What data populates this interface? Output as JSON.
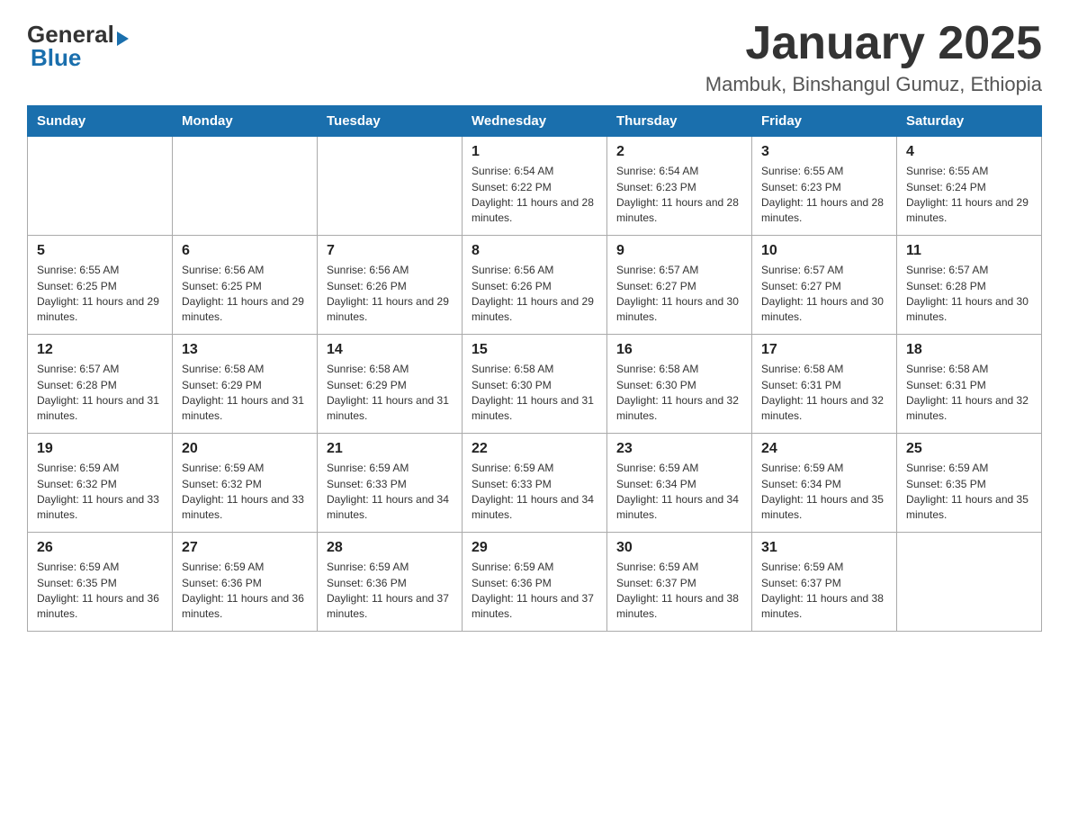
{
  "header": {
    "logo_general": "General",
    "logo_blue": "Blue",
    "title": "January 2025",
    "subtitle": "Mambuk, Binshangul Gumuz, Ethiopia"
  },
  "weekdays": [
    "Sunday",
    "Monday",
    "Tuesday",
    "Wednesday",
    "Thursday",
    "Friday",
    "Saturday"
  ],
  "weeks": [
    [
      {
        "day": "",
        "info": ""
      },
      {
        "day": "",
        "info": ""
      },
      {
        "day": "",
        "info": ""
      },
      {
        "day": "1",
        "info": "Sunrise: 6:54 AM\nSunset: 6:22 PM\nDaylight: 11 hours and 28 minutes."
      },
      {
        "day": "2",
        "info": "Sunrise: 6:54 AM\nSunset: 6:23 PM\nDaylight: 11 hours and 28 minutes."
      },
      {
        "day": "3",
        "info": "Sunrise: 6:55 AM\nSunset: 6:23 PM\nDaylight: 11 hours and 28 minutes."
      },
      {
        "day": "4",
        "info": "Sunrise: 6:55 AM\nSunset: 6:24 PM\nDaylight: 11 hours and 29 minutes."
      }
    ],
    [
      {
        "day": "5",
        "info": "Sunrise: 6:55 AM\nSunset: 6:25 PM\nDaylight: 11 hours and 29 minutes."
      },
      {
        "day": "6",
        "info": "Sunrise: 6:56 AM\nSunset: 6:25 PM\nDaylight: 11 hours and 29 minutes."
      },
      {
        "day": "7",
        "info": "Sunrise: 6:56 AM\nSunset: 6:26 PM\nDaylight: 11 hours and 29 minutes."
      },
      {
        "day": "8",
        "info": "Sunrise: 6:56 AM\nSunset: 6:26 PM\nDaylight: 11 hours and 29 minutes."
      },
      {
        "day": "9",
        "info": "Sunrise: 6:57 AM\nSunset: 6:27 PM\nDaylight: 11 hours and 30 minutes."
      },
      {
        "day": "10",
        "info": "Sunrise: 6:57 AM\nSunset: 6:27 PM\nDaylight: 11 hours and 30 minutes."
      },
      {
        "day": "11",
        "info": "Sunrise: 6:57 AM\nSunset: 6:28 PM\nDaylight: 11 hours and 30 minutes."
      }
    ],
    [
      {
        "day": "12",
        "info": "Sunrise: 6:57 AM\nSunset: 6:28 PM\nDaylight: 11 hours and 31 minutes."
      },
      {
        "day": "13",
        "info": "Sunrise: 6:58 AM\nSunset: 6:29 PM\nDaylight: 11 hours and 31 minutes."
      },
      {
        "day": "14",
        "info": "Sunrise: 6:58 AM\nSunset: 6:29 PM\nDaylight: 11 hours and 31 minutes."
      },
      {
        "day": "15",
        "info": "Sunrise: 6:58 AM\nSunset: 6:30 PM\nDaylight: 11 hours and 31 minutes."
      },
      {
        "day": "16",
        "info": "Sunrise: 6:58 AM\nSunset: 6:30 PM\nDaylight: 11 hours and 32 minutes."
      },
      {
        "day": "17",
        "info": "Sunrise: 6:58 AM\nSunset: 6:31 PM\nDaylight: 11 hours and 32 minutes."
      },
      {
        "day": "18",
        "info": "Sunrise: 6:58 AM\nSunset: 6:31 PM\nDaylight: 11 hours and 32 minutes."
      }
    ],
    [
      {
        "day": "19",
        "info": "Sunrise: 6:59 AM\nSunset: 6:32 PM\nDaylight: 11 hours and 33 minutes."
      },
      {
        "day": "20",
        "info": "Sunrise: 6:59 AM\nSunset: 6:32 PM\nDaylight: 11 hours and 33 minutes."
      },
      {
        "day": "21",
        "info": "Sunrise: 6:59 AM\nSunset: 6:33 PM\nDaylight: 11 hours and 34 minutes."
      },
      {
        "day": "22",
        "info": "Sunrise: 6:59 AM\nSunset: 6:33 PM\nDaylight: 11 hours and 34 minutes."
      },
      {
        "day": "23",
        "info": "Sunrise: 6:59 AM\nSunset: 6:34 PM\nDaylight: 11 hours and 34 minutes."
      },
      {
        "day": "24",
        "info": "Sunrise: 6:59 AM\nSunset: 6:34 PM\nDaylight: 11 hours and 35 minutes."
      },
      {
        "day": "25",
        "info": "Sunrise: 6:59 AM\nSunset: 6:35 PM\nDaylight: 11 hours and 35 minutes."
      }
    ],
    [
      {
        "day": "26",
        "info": "Sunrise: 6:59 AM\nSunset: 6:35 PM\nDaylight: 11 hours and 36 minutes."
      },
      {
        "day": "27",
        "info": "Sunrise: 6:59 AM\nSunset: 6:36 PM\nDaylight: 11 hours and 36 minutes."
      },
      {
        "day": "28",
        "info": "Sunrise: 6:59 AM\nSunset: 6:36 PM\nDaylight: 11 hours and 37 minutes."
      },
      {
        "day": "29",
        "info": "Sunrise: 6:59 AM\nSunset: 6:36 PM\nDaylight: 11 hours and 37 minutes."
      },
      {
        "day": "30",
        "info": "Sunrise: 6:59 AM\nSunset: 6:37 PM\nDaylight: 11 hours and 38 minutes."
      },
      {
        "day": "31",
        "info": "Sunrise: 6:59 AM\nSunset: 6:37 PM\nDaylight: 11 hours and 38 minutes."
      },
      {
        "day": "",
        "info": ""
      }
    ]
  ]
}
